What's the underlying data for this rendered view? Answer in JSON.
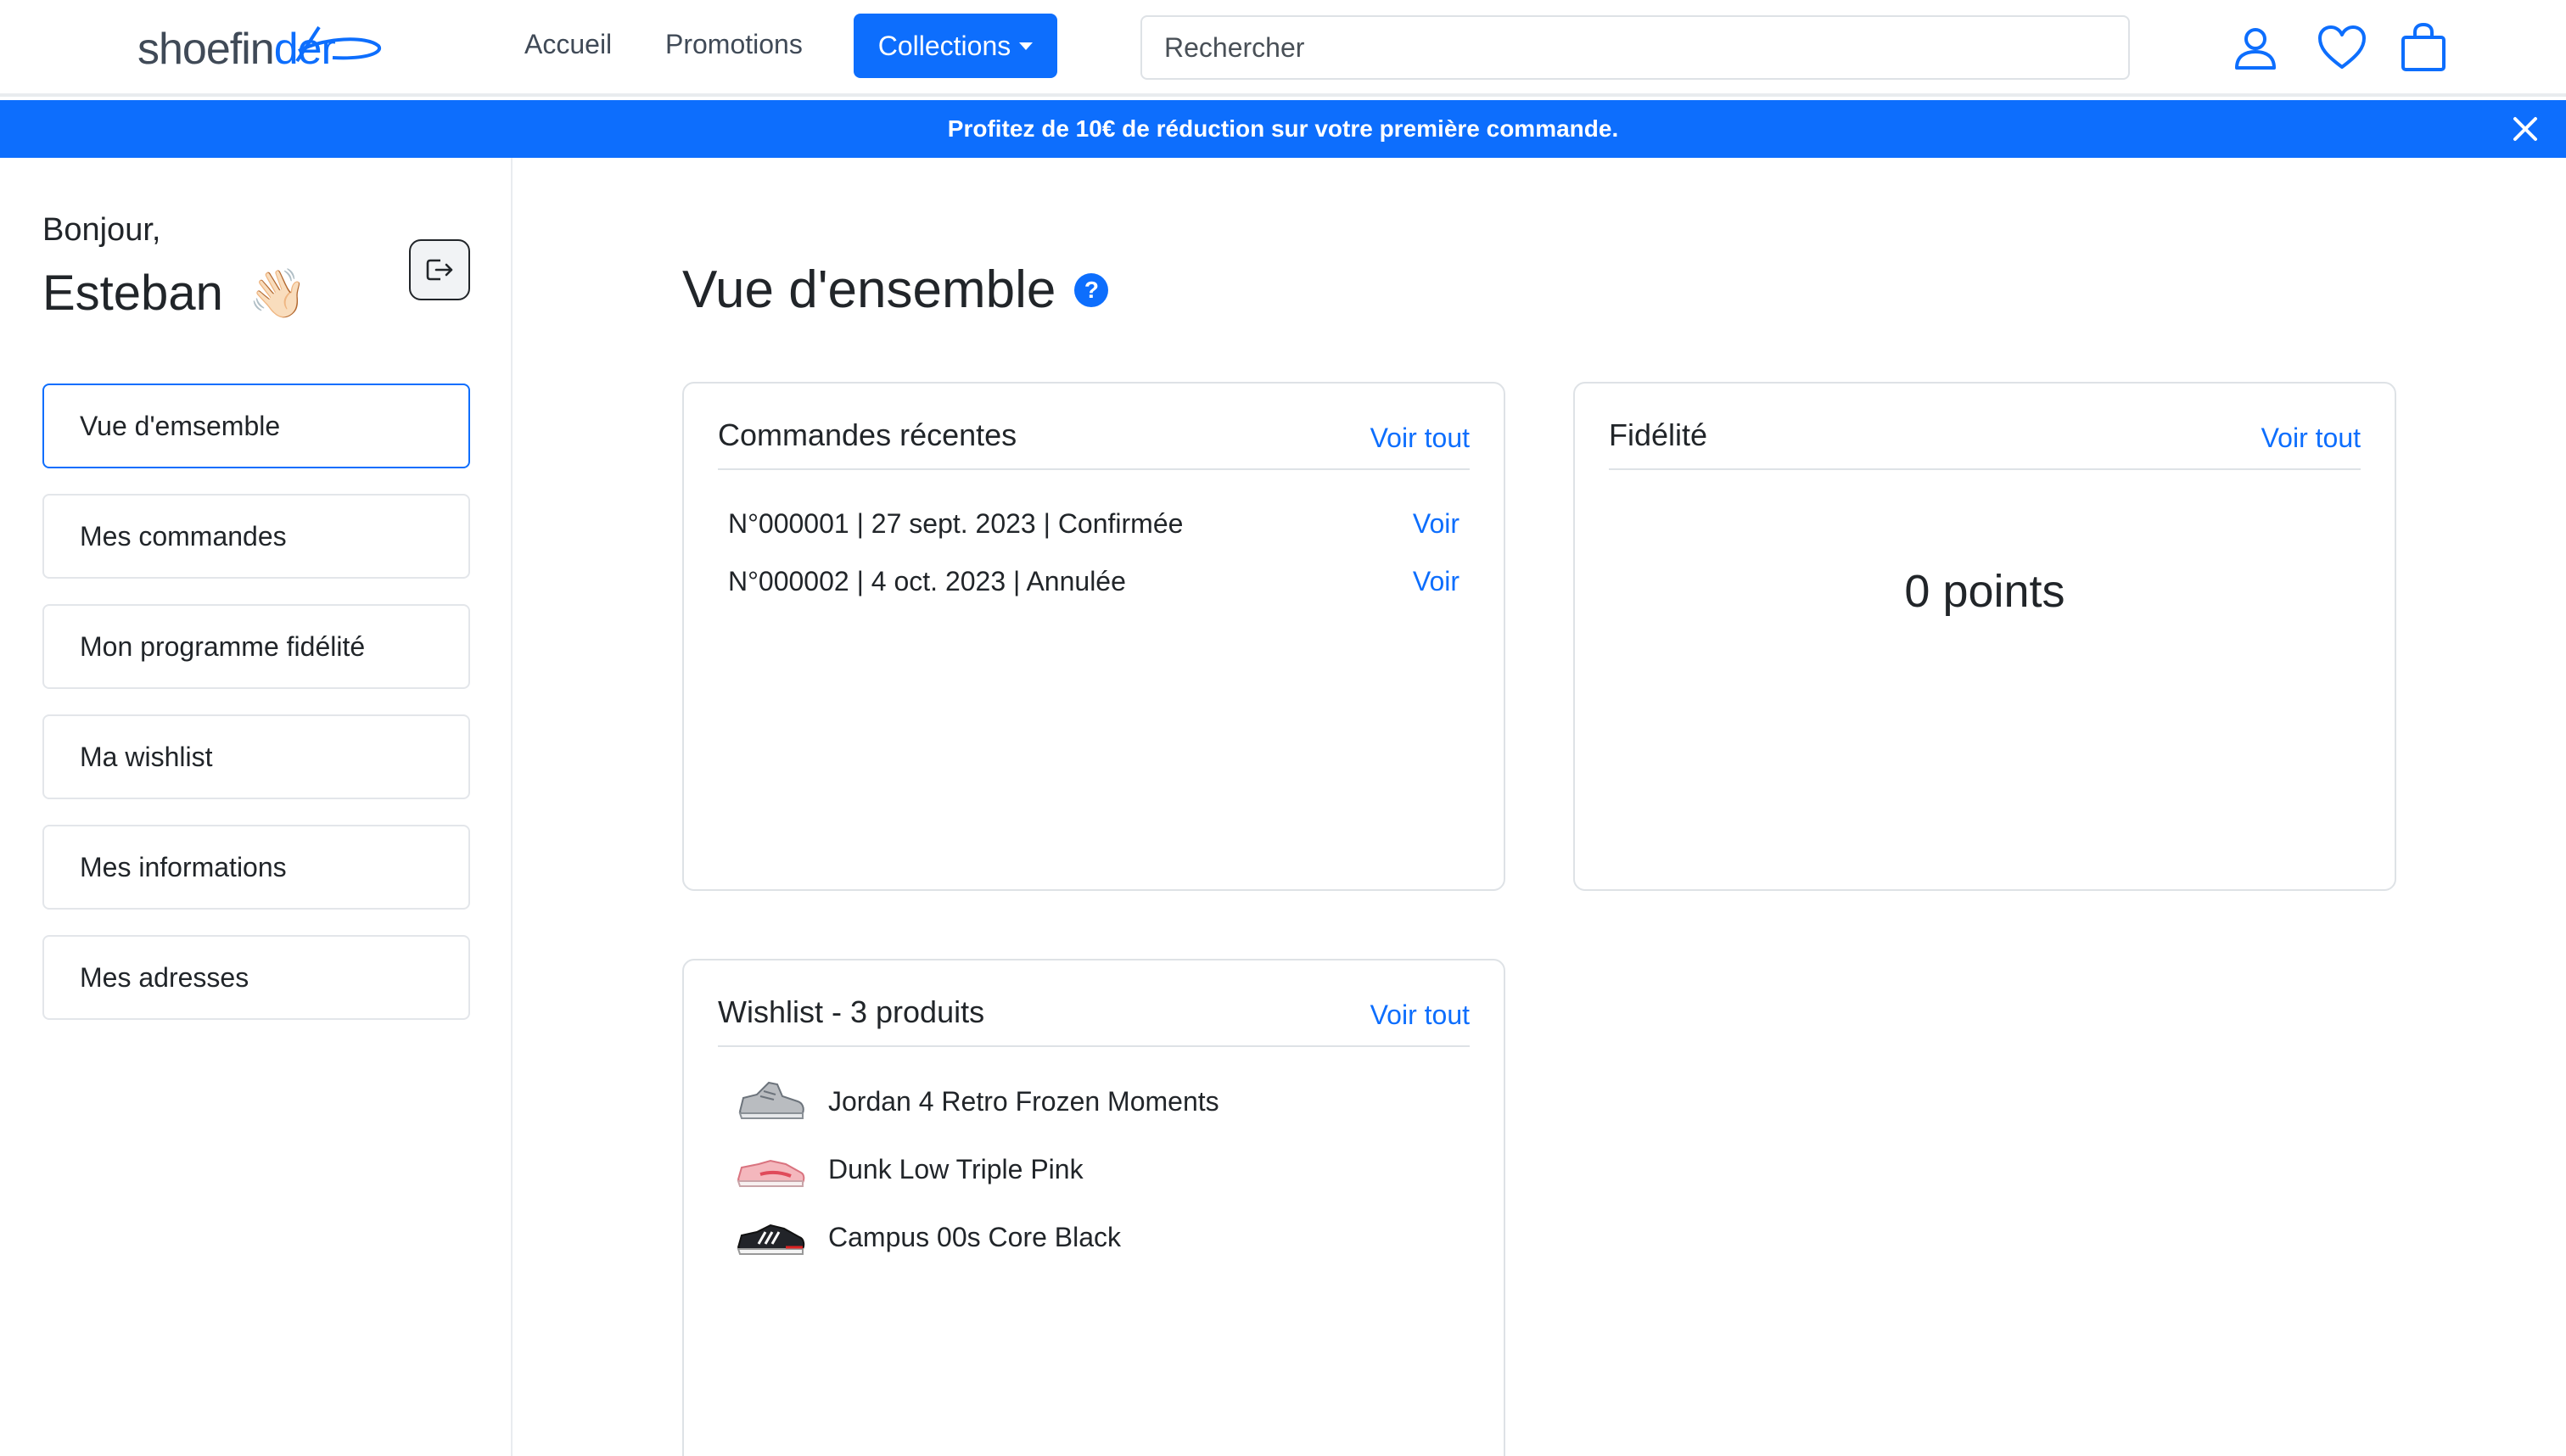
{
  "header": {
    "logo_prefix": "shoefin",
    "logo_suffix": "der",
    "nav": {
      "home": "Accueil",
      "promotions": "Promotions",
      "collections": "Collections"
    },
    "search_placeholder": "Rechercher",
    "icons": [
      "user-icon",
      "heart-icon",
      "shopping-bag-icon"
    ]
  },
  "promo": {
    "text": "Profitez de 10€ de réduction sur votre première commande."
  },
  "sidebar": {
    "greeting": "Bonjour,",
    "name": "Esteban",
    "wave": "👋🏻",
    "items": [
      {
        "label": "Vue d'emsemble",
        "active": true
      },
      {
        "label": "Mes commandes",
        "active": false
      },
      {
        "label": "Mon programme fidélité",
        "active": false
      },
      {
        "label": "Ma wishlist",
        "active": false
      },
      {
        "label": "Mes informations",
        "active": false
      },
      {
        "label": "Mes adresses",
        "active": false
      }
    ]
  },
  "main": {
    "title": "Vue d'ensemble",
    "help": "?",
    "orders": {
      "title": "Commandes récentes",
      "see_all": "Voir tout",
      "rows": [
        {
          "text": "N°000001 | 27 sept. 2023 | Confirmée",
          "link": "Voir"
        },
        {
          "text": "N°000002 | 4 oct. 2023 | Annulée",
          "link": "Voir"
        }
      ]
    },
    "fidelity": {
      "title": "Fidélité",
      "see_all": "Voir tout",
      "points": "0 points"
    },
    "wishlist": {
      "title": "Wishlist - 3 produits",
      "see_all": "Voir tout",
      "items": [
        {
          "name": "Jordan 4 Retro Frozen Moments"
        },
        {
          "name": "Dunk Low Triple Pink"
        },
        {
          "name": "Campus 00s Core Black"
        }
      ]
    }
  },
  "colors": {
    "primary": "#0d6efd",
    "text": "#212529",
    "border": "#dee2e6"
  }
}
